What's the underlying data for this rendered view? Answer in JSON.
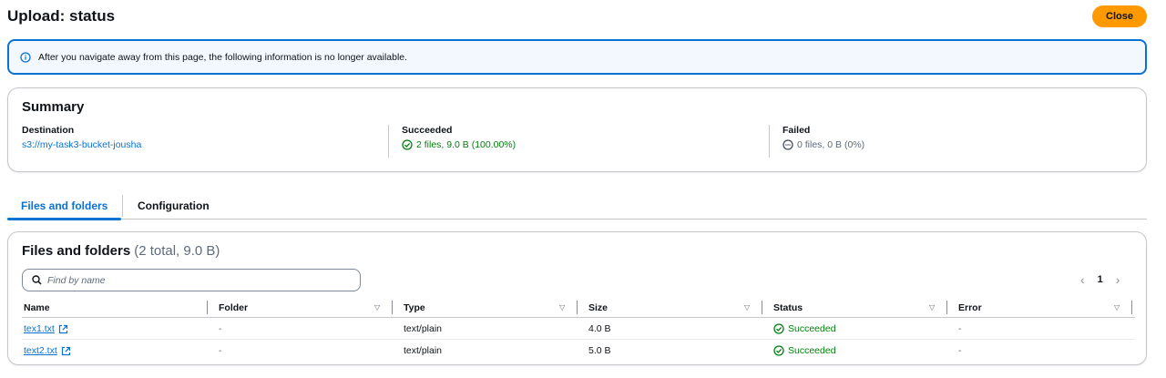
{
  "page": {
    "title": "Upload: status",
    "close_label": "Close"
  },
  "alert": {
    "text": "After you navigate away from this page, the following information is no longer available."
  },
  "summary": {
    "title": "Summary",
    "destination": {
      "label": "Destination",
      "value": "s3://my-task3-bucket-jousha"
    },
    "succeeded": {
      "label": "Succeeded",
      "value": "2 files, 9.0 B (100.00%)"
    },
    "failed": {
      "label": "Failed",
      "value": "0 files, 0 B (0%)"
    }
  },
  "tabs": [
    {
      "label": "Files and folders"
    },
    {
      "label": "Configuration"
    }
  ],
  "files": {
    "title": "Files and folders",
    "count": "(2 total, 9.0 B)",
    "search_placeholder": "Find by name",
    "page": "1",
    "columns": [
      "Name",
      "Folder",
      "Type",
      "Size",
      "Status",
      "Error"
    ],
    "rows": [
      {
        "name": "tex1.txt",
        "folder": "-",
        "type": "text/plain",
        "size": "4.0 B",
        "status": "Succeeded",
        "error": "-"
      },
      {
        "name": "text2.txt",
        "folder": "-",
        "type": "text/plain",
        "size": "5.0 B",
        "status": "Succeeded",
        "error": "-"
      }
    ]
  },
  "colors": {
    "accent": "#0972d3",
    "success": "#037f0c",
    "primary_button": "#ff9900"
  },
  "icons": [
    "info-icon",
    "check-circle-icon",
    "minus-circle-icon",
    "search-icon",
    "external-link-icon",
    "sort-down-icon",
    "chevron-left-icon",
    "chevron-right-icon"
  ]
}
